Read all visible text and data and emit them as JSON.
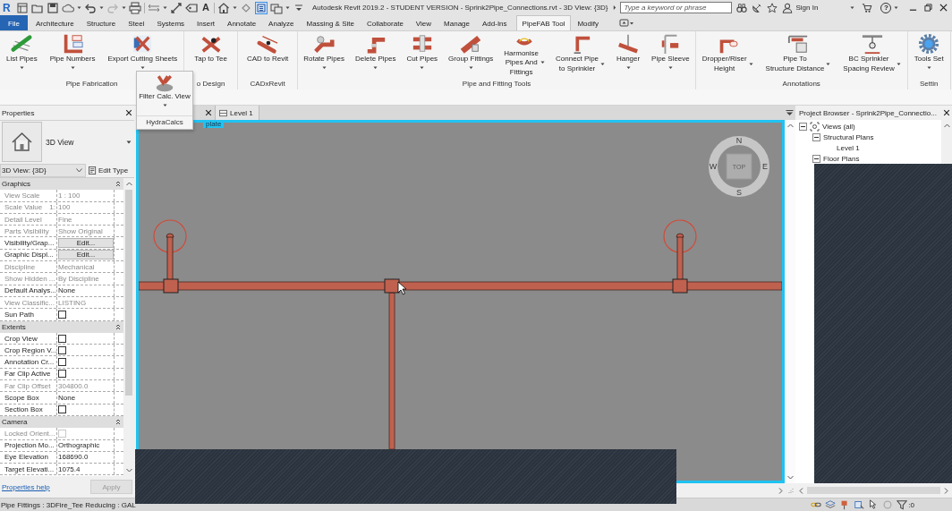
{
  "quick_access_toolbar": {
    "logo": "R",
    "text_tool": "A",
    "redo_enabled": false,
    "thin_lines_on": true
  },
  "title_bar": {
    "title": "Autodesk Revit 2019.2 - STUDENT VERSION - Sprink2Pipe_Connections.rvt - 3D View: {3D}",
    "search": {
      "placeholder": "Type a keyword or phrase"
    },
    "sign_in": "Sign In",
    "help": "?"
  },
  "ribbon_tabs": [
    {
      "label": "File",
      "kind": "application",
      "selected": false
    },
    {
      "label": "Architecture",
      "kind": "tab",
      "selected": false
    },
    {
      "label": "Structure",
      "kind": "tab",
      "selected": false
    },
    {
      "label": "Steel",
      "kind": "tab",
      "selected": false
    },
    {
      "label": "Systems",
      "kind": "tab",
      "selected": false
    },
    {
      "label": "Insert",
      "kind": "tab",
      "selected": false
    },
    {
      "label": "Annotate",
      "kind": "tab",
      "selected": false
    },
    {
      "label": "Analyze",
      "kind": "tab",
      "selected": false
    },
    {
      "label": "Massing & Site",
      "kind": "tab",
      "selected": false
    },
    {
      "label": "Collaborate",
      "kind": "tab",
      "selected": false
    },
    {
      "label": "View",
      "kind": "tab",
      "selected": false
    },
    {
      "label": "Manage",
      "kind": "tab",
      "selected": false
    },
    {
      "label": "Add-Ins",
      "kind": "tab",
      "selected": false
    },
    {
      "label": "PipeFAB Tool",
      "kind": "tab",
      "selected": true
    },
    {
      "label": "Modify",
      "kind": "tab",
      "selected": false
    }
  ],
  "ribbon_panels": [
    {
      "title": "Pipe Fabrication",
      "buttons": [
        {
          "lines": [
            "List Pipes"
          ],
          "kind": "dropdown"
        },
        {
          "lines": [
            "Pipe Numbers"
          ],
          "kind": "dropdown"
        },
        {
          "lines": [
            "Export Cutting Sheets"
          ],
          "kind": "dropdown"
        }
      ]
    },
    {
      "title": "o Design",
      "buttons": [
        {
          "lines": [
            "Tap to Tee"
          ],
          "kind": "plain"
        }
      ]
    },
    {
      "title": "CADxRevit",
      "buttons": [
        {
          "lines": [
            "CAD to Revit"
          ],
          "kind": "plain"
        }
      ]
    },
    {
      "title": "Pipe and Fitting Tools",
      "buttons": [
        {
          "lines": [
            "Rotate Pipes"
          ],
          "kind": "dropdown"
        },
        {
          "lines": [
            "Delete Pipes"
          ],
          "kind": "dropdown"
        },
        {
          "lines": [
            "Cut Pipes"
          ],
          "kind": "dropdown"
        },
        {
          "lines": [
            "Group Fittings"
          ],
          "kind": "dropdown"
        },
        {
          "lines": [
            "Harmonise",
            "Pipes And",
            "Fittings"
          ],
          "kind": "sidedropdown"
        },
        {
          "lines": [
            "Connect Pipe",
            "to Sprinkler"
          ],
          "kind": "sidedropdown"
        },
        {
          "lines": [
            "Hanger"
          ],
          "kind": "dropdown"
        },
        {
          "lines": [
            "Pipe Sleeve"
          ],
          "kind": "dropdown"
        }
      ]
    },
    {
      "title": "Annotations",
      "buttons": [
        {
          "lines": [
            "Dropper/Riser",
            "Height"
          ],
          "kind": "sidedropdown"
        },
        {
          "lines": [
            "Pipe To",
            "Structure Distance"
          ],
          "kind": "sidedropdown"
        },
        {
          "lines": [
            "BC Sprinkler",
            "Spacing Review"
          ],
          "kind": "sidedropdown"
        }
      ]
    },
    {
      "title": "Settin",
      "buttons": [
        {
          "lines": [
            "Tools Set"
          ],
          "kind": "dropdown"
        }
      ]
    }
  ],
  "flyout_panel": {
    "title": "HydraCalcs",
    "button": {
      "lines": [
        "Filter Calc. View"
      ],
      "kind": "dropdown"
    }
  },
  "properties": {
    "title": "Properties",
    "type_name": "3D View",
    "instance": "3D View: {3D}",
    "edit_type": "Edit Type",
    "groups": [
      {
        "name": "Graphics",
        "expanded": true,
        "rows": [
          {
            "name": "View Scale",
            "kind": "text",
            "value": "1 : 100",
            "disabled": true
          },
          {
            "name": "Scale Value",
            "suffix": "1:",
            "kind": "text",
            "value": "100",
            "disabled": true
          },
          {
            "name": "Detail Level",
            "kind": "text",
            "value": "Fine",
            "disabled": true
          },
          {
            "name": "Parts Visibility",
            "kind": "text",
            "value": "Show Original",
            "disabled": true
          },
          {
            "name": "Visibility/Grap...",
            "kind": "button",
            "value": "Edit...",
            "disabled": false
          },
          {
            "name": "Graphic Displ...",
            "kind": "button",
            "value": "Edit...",
            "disabled": false
          },
          {
            "name": "Discipline",
            "kind": "text",
            "value": "Mechanical",
            "disabled": true
          },
          {
            "name": "Show Hidden ...",
            "kind": "text",
            "value": "By Discipline",
            "disabled": true
          },
          {
            "name": "Default Analys...",
            "kind": "text",
            "value": "None",
            "disabled": false
          },
          {
            "name": "View Classific...",
            "kind": "text",
            "value": "LISTING",
            "disabled": true
          },
          {
            "name": "Sun Path",
            "kind": "checkbox",
            "checked": false,
            "disabled": false
          }
        ]
      },
      {
        "name": "Extents",
        "expanded": true,
        "rows": [
          {
            "name": "Crop View",
            "kind": "checkbox",
            "checked": false,
            "disabled": false
          },
          {
            "name": "Crop Region V...",
            "kind": "checkbox",
            "checked": false,
            "disabled": false
          },
          {
            "name": "Annotation Cr...",
            "kind": "checkbox",
            "checked": false,
            "disabled": false
          },
          {
            "name": "Far Clip Active",
            "kind": "checkbox",
            "checked": false,
            "disabled": false
          },
          {
            "name": "Far Clip Offset",
            "kind": "text",
            "value": "304800.0",
            "disabled": true
          },
          {
            "name": "Scope Box",
            "kind": "text",
            "value": "None",
            "disabled": false
          },
          {
            "name": "Section Box",
            "kind": "checkbox",
            "checked": false,
            "disabled": false
          }
        ]
      },
      {
        "name": "Camera",
        "expanded": true,
        "rows": [
          {
            "name": "Locked Orient...",
            "kind": "checkbox",
            "checked": false,
            "disabled": true
          },
          {
            "name": "Projection Mo...",
            "kind": "text",
            "value": "Orthographic",
            "disabled": false
          },
          {
            "name": "Eye Elevation",
            "kind": "text",
            "value": "168690.0",
            "disabled": false
          },
          {
            "name": "Target Elevati...",
            "kind": "text",
            "value": "1075.4",
            "disabled": false
          }
        ]
      }
    ],
    "help_link": "Properties help",
    "apply": {
      "label": "Apply",
      "disabled": true
    }
  },
  "view": {
    "tabs": [
      {
        "label": "Level 1",
        "selected": false
      }
    ],
    "frame_label": "plate",
    "viewcube": {
      "north": "N",
      "west": "W",
      "face": "TOP",
      "east": "E",
      "south": "S"
    }
  },
  "project_browser": {
    "title": "Project Browser - Sprink2Pipe_Connectio...",
    "tree": [
      {
        "label": "Views (all)",
        "expanded": true,
        "children": [
          {
            "label": "Structural Plans",
            "expanded": true,
            "children": [
              {
                "label": "Level 1"
              }
            ]
          },
          {
            "label": "Floor Plans",
            "expanded": true
          }
        ]
      }
    ]
  },
  "status_bar": {
    "text": "Pipe Fittings : 3DFire_Tee Reducing : GAL",
    "filter_count": ":0"
  }
}
